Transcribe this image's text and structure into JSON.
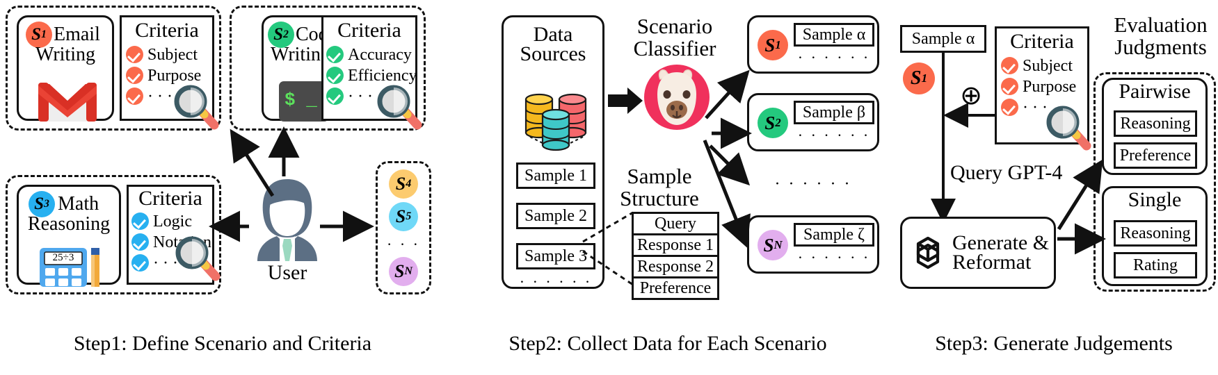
{
  "steps": [
    {
      "caption": "Step1: Define Scenario and Criteria"
    },
    {
      "caption": "Step2: Collect Data for Each Scenario"
    },
    {
      "caption": "Step3: Generate Judgements"
    }
  ],
  "step1": {
    "scenarios": [
      {
        "badge": "S",
        "sub": "1",
        "color": "#FB6A4B",
        "title_line1": "Email",
        "title_line2": "Writing",
        "icon": "gmail-icon",
        "criteria": {
          "title": "Criteria",
          "items": [
            "Subject",
            "Purpose",
            "· · ·"
          ]
        }
      },
      {
        "badge": "S",
        "sub": "2",
        "color": "#24C97E",
        "title_line1": "Code",
        "title_line2": "Writing",
        "icon": "terminal-icon",
        "terminal_prompt": "$ _",
        "criteria": {
          "title": "Criteria",
          "items": [
            "Accuracy",
            "Efficiency",
            "· · ·"
          ]
        }
      },
      {
        "badge": "S",
        "sub": "3",
        "color": "#27B0F0",
        "title_line1": "Math",
        "title_line2": "Reasoning",
        "icon": "calculator-icon",
        "calculator_display": "25÷3",
        "criteria": {
          "title": "Criteria",
          "items": [
            "Logic",
            "Notation",
            "· · ·"
          ]
        }
      }
    ],
    "user_label": "User",
    "user_icon": "user-avatar-icon",
    "more_scenarios": [
      {
        "badge": "S",
        "sub": "4",
        "color": "#FCCB6F"
      },
      {
        "badge": "S",
        "sub": "5",
        "color": "#6FD8F7"
      },
      {
        "badge": "S",
        "sub": "N",
        "color": "#E2AEEE"
      }
    ],
    "more_dots": "· · ·"
  },
  "step2": {
    "data_sources": {
      "title_line1": "Data",
      "title_line2": "Sources",
      "icon": "database-stack-icon"
    },
    "samples": [
      "Sample 1",
      "Sample 2",
      "Sample 3"
    ],
    "samples_dots": "· · · · · ·",
    "classifier": {
      "title_line1": "Scenario",
      "title_line2": "Classifier",
      "icon": "llama-avatar-icon"
    },
    "sample_structure": {
      "title_line1": "Sample",
      "title_line2": "Structure",
      "rows": [
        "Query",
        "Response 1",
        "Response 2",
        "Preference"
      ]
    },
    "buckets": [
      {
        "badge": "S",
        "sub": "1",
        "color": "#FB6A4B",
        "sample": "Sample α",
        "dots": "· · · · · ·"
      },
      {
        "badge": "S",
        "sub": "2",
        "color": "#24C97E",
        "sample": "Sample β",
        "dots": "· · · · · ·"
      },
      {
        "badge": "S",
        "sub": "N",
        "color": "#E2AEEE",
        "sample": "Sample ζ",
        "dots": "· · · · · ·"
      }
    ],
    "buckets_dots": "· · · · · ·"
  },
  "step3": {
    "sample_box": "Sample α",
    "badge": {
      "badge": "S",
      "sub": "1",
      "color": "#FB6A4B"
    },
    "plus_symbol": "⊕",
    "criteria": {
      "title": "Criteria",
      "items": [
        "Subject",
        "Purpose",
        "· · ·"
      ],
      "color": "#FB6A4B"
    },
    "query_label": "Query GPT-4",
    "generate": {
      "line1": "Generate &",
      "line2": "Reformat",
      "icon": "openai-logo-icon"
    },
    "judgments": {
      "title_line1": "Evaluation",
      "title_line2": "Judgments",
      "groups": [
        {
          "title": "Pairwise",
          "items": [
            "Reasoning",
            "Preference"
          ]
        },
        {
          "title": "Single",
          "items": [
            "Reasoning",
            "Rating"
          ]
        }
      ]
    }
  },
  "colors": {
    "orange": "#FB6A4B",
    "green": "#24C97E",
    "blue": "#27B0F0",
    "yellow": "#FCCB6F",
    "lightblue": "#6FD8F7",
    "purple": "#E2AEEE",
    "ink": "#111111",
    "user_navy": "#5C6F84",
    "tie_green": "#9BD9C0"
  }
}
